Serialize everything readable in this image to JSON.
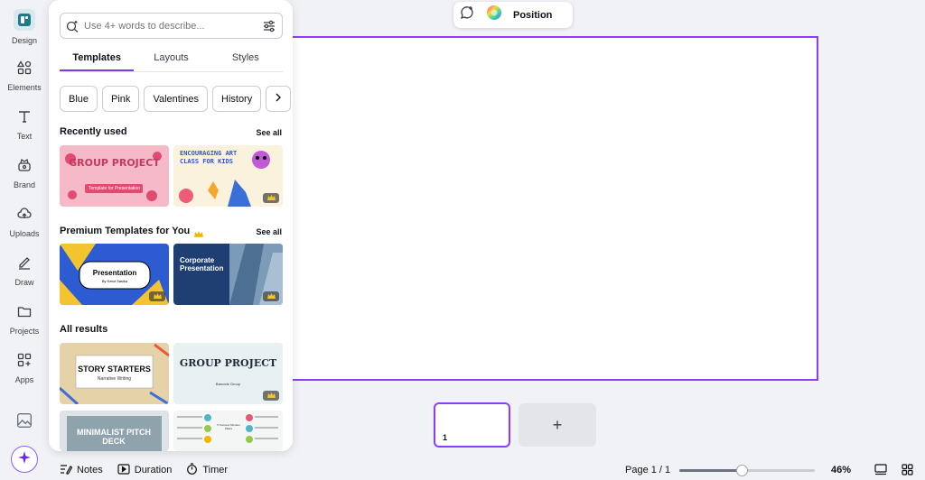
{
  "rail": {
    "items": [
      {
        "label": "Design",
        "icon": "design-icon"
      },
      {
        "label": "Elements",
        "icon": "elements-icon"
      },
      {
        "label": "Text",
        "icon": "text-icon"
      },
      {
        "label": "Brand",
        "icon": "brand-icon"
      },
      {
        "label": "Uploads",
        "icon": "uploads-icon"
      },
      {
        "label": "Draw",
        "icon": "draw-icon"
      },
      {
        "label": "Projects",
        "icon": "projects-icon"
      },
      {
        "label": "Apps",
        "icon": "apps-icon"
      }
    ]
  },
  "panel": {
    "search_placeholder": "Use 4+ words to describe...",
    "tabs": [
      "Templates",
      "Layouts",
      "Styles"
    ],
    "chips": [
      "Blue",
      "Pink",
      "Valentines",
      "History"
    ],
    "recent": {
      "title": "Recently used",
      "see_all": "See all",
      "thumbs": [
        {
          "title": "GROUP PROJECT",
          "subtitle": "Template for Presentation"
        },
        {
          "title": "ENCOURAGING ART CLASS FOR KIDS"
        }
      ]
    },
    "premium": {
      "title": "Premium Templates for You",
      "see_all": "See all",
      "thumbs": [
        {
          "title": "Presentation",
          "subtitle": "By Ketut Sasika"
        },
        {
          "title": "Corporate Presentation"
        }
      ]
    },
    "results": {
      "title": "All results",
      "thumbs": [
        {
          "title": "STORY STARTERS",
          "subtitle": "Narrative Writing"
        },
        {
          "title": "GROUP PROJECT",
          "subtitle": "Barcode Group"
        },
        {
          "title": "MINIMALIST PITCH DECK"
        },
        {
          "title": "5 Success Mindset Pillars"
        }
      ]
    }
  },
  "toolbar": {
    "position_label": "Position"
  },
  "pages": {
    "current_page_number": "1",
    "add_symbol": "+"
  },
  "bottom": {
    "notes": "Notes",
    "duration": "Duration",
    "timer": "Timer",
    "page_indicator": "Page 1 / 1",
    "zoom": "46%",
    "zoom_fraction": 0.46
  }
}
